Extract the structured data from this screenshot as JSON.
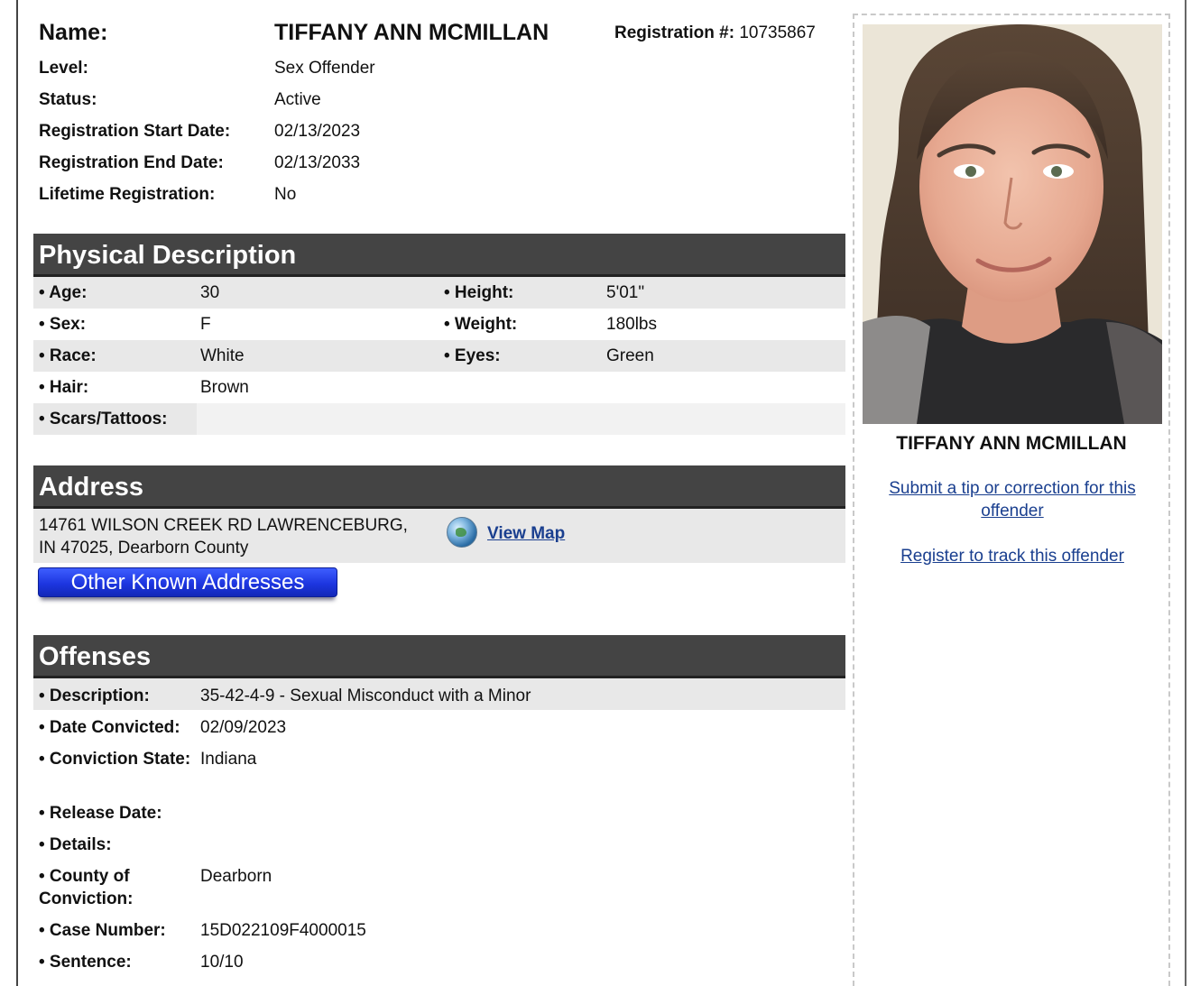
{
  "header": {
    "name_label": "Name:",
    "name_value": "TIFFANY ANN MCMILLAN",
    "registration_label": "Registration #:",
    "registration_value": "10735867"
  },
  "info": [
    {
      "label": "Level:",
      "value": "Sex Offender"
    },
    {
      "label": "Status:",
      "value": "Active"
    },
    {
      "label": "Registration Start Date:",
      "value": "02/13/2023"
    },
    {
      "label": "Registration End Date:",
      "value": "02/13/2033"
    },
    {
      "label": "Lifetime Registration:",
      "value": "No"
    }
  ],
  "physical": {
    "title": "Physical Description",
    "rows": [
      {
        "l1": "• Age:",
        "v1": "30",
        "l2": "• Height:",
        "v2": "5'01\""
      },
      {
        "l1": "• Sex:",
        "v1": "F",
        "l2": "• Weight:",
        "v2": "180lbs"
      },
      {
        "l1": "• Race:",
        "v1": "White",
        "l2": "• Eyes:",
        "v2": "Green"
      },
      {
        "l1": "• Hair:",
        "v1": "Brown"
      },
      {
        "l1": "• Scars/Tattoos:",
        "v1": ""
      }
    ]
  },
  "address": {
    "title": "Address",
    "line1": "14761 WILSON CREEK RD LAWRENCEBURG,",
    "line2": "IN 47025, Dearborn County",
    "view_map": "View Map",
    "other_addresses_button": "Other Known Addresses"
  },
  "offenses": {
    "title": "Offenses",
    "rows": [
      {
        "label": "• Description:",
        "value": "35-42-4-9 - Sexual Misconduct with a Minor"
      },
      {
        "label": "• Date Convicted:",
        "value": "02/09/2023"
      },
      {
        "label": "• Conviction State:",
        "value": "Indiana"
      },
      {
        "label": "• Release Date:",
        "value": ""
      },
      {
        "label": "• Details:",
        "value": ""
      },
      {
        "label": "• County of Conviction:",
        "value": "Dearborn"
      },
      {
        "label": "• Case Number:",
        "value": "15D022109F4000015"
      },
      {
        "label": "• Sentence:",
        "value": "10/10"
      }
    ]
  },
  "sidebar": {
    "name": "TIFFANY ANN MCMILLAN",
    "tip_link": "Submit a tip or correction for this offender",
    "track_link": "Register to track this offender"
  },
  "colors": {
    "section_header": "#444444",
    "shaded_row": "#e8e8e8",
    "link": "#1a3f8f",
    "button": "#1d36e0"
  }
}
